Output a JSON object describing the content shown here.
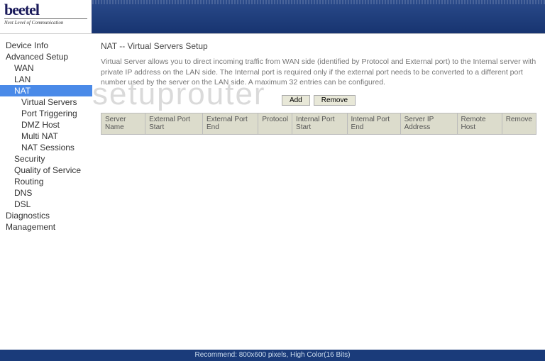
{
  "logo": {
    "brand": "beetel",
    "tagline": "Next Level of Communication"
  },
  "nav": {
    "items": [
      {
        "label": "Device Info",
        "level": 1
      },
      {
        "label": "Advanced Setup",
        "level": 1
      },
      {
        "label": "WAN",
        "level": 2
      },
      {
        "label": "LAN",
        "level": 2
      },
      {
        "label": "NAT",
        "level": 2,
        "active": true
      },
      {
        "label": "Virtual Servers",
        "level": 3
      },
      {
        "label": "Port Triggering",
        "level": 3
      },
      {
        "label": "DMZ Host",
        "level": 3
      },
      {
        "label": "Multi NAT",
        "level": 3
      },
      {
        "label": "NAT Sessions",
        "level": 3
      },
      {
        "label": "Security",
        "level": 2
      },
      {
        "label": "Quality of Service",
        "level": 2
      },
      {
        "label": "Routing",
        "level": 2
      },
      {
        "label": "DNS",
        "level": 2
      },
      {
        "label": "DSL",
        "level": 2
      },
      {
        "label": "Diagnostics",
        "level": 1
      },
      {
        "label": "Management",
        "level": 1
      }
    ]
  },
  "page": {
    "title": "NAT -- Virtual Servers Setup",
    "description": "Virtual Server allows you to direct incoming traffic from WAN side (identified by Protocol and External port) to the Internal server with private IP address on the LAN side. The Internal port is required only if the external port needs to be converted to a different port number used by the server on the LAN side. A maximum 32 entries can be configured."
  },
  "buttons": {
    "add": "Add",
    "remove": "Remove"
  },
  "table": {
    "headers": [
      "Server Name",
      "External Port Start",
      "External Port End",
      "Protocol",
      "Internal Port Start",
      "Internal Port End",
      "Server IP Address",
      "Remote Host",
      "Remove"
    ]
  },
  "footer": {
    "text": "Recommend: 800x600 pixels, High Color(16 Bits)"
  },
  "watermark": "setuprouter"
}
